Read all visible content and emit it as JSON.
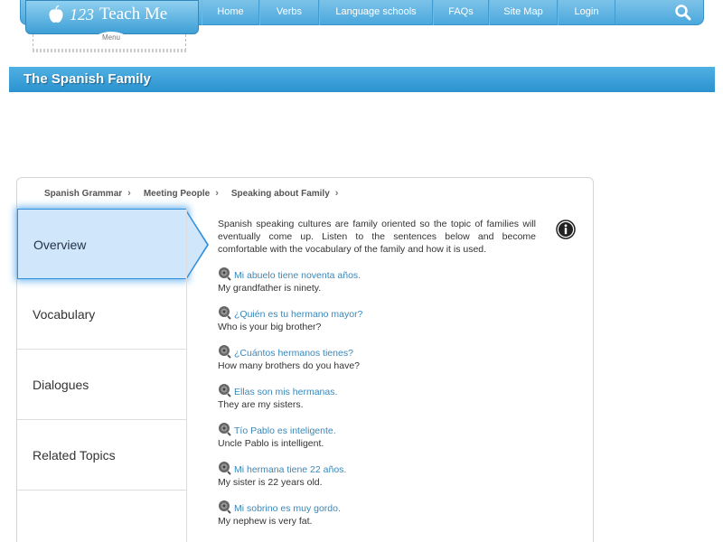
{
  "header": {
    "logo_num": "123",
    "logo_text": "Teach Me",
    "menu_label": "Menu",
    "nav": [
      "Home",
      "Verbs",
      "Language schools",
      "FAQs",
      "Site Map",
      "Login"
    ]
  },
  "title": "The Spanish Family",
  "breadcrumb": [
    "Spanish Grammar",
    "Meeting People",
    "Speaking about Family"
  ],
  "sidebar": [
    "Overview",
    "Vocabulary",
    "Dialogues",
    "Related Topics"
  ],
  "intro": "Spanish speaking cultures are family oriented so the topic of families will eventually come up. Listen to the sentences below and become comfortable with the vocabulary of the family and how it is used.",
  "sentences": [
    {
      "es": "Mi abuelo tiene noventa años.",
      "en": "My grandfather is ninety."
    },
    {
      "es": "¿Quién es tu hermano mayor?",
      "en": "Who is your big brother?"
    },
    {
      "es": "¿Cuántos hermanos tienes?",
      "en": "How many brothers do you have?"
    },
    {
      "es": "Ellas son mis hermanas.",
      "en": "They are my sisters."
    },
    {
      "es": "Tío Pablo es inteligente.",
      "en": "Uncle Pablo is intelligent."
    },
    {
      "es": "Mi hermana tiene 22 años.",
      "en": "My sister is 22 years old."
    },
    {
      "es": "Mi sobrino es muy gordo.",
      "en": "My nephew is very fat."
    }
  ],
  "colors": {
    "accent": "#2c92cf",
    "link": "#3a87b8",
    "active_bg": "#cfe6fb"
  }
}
